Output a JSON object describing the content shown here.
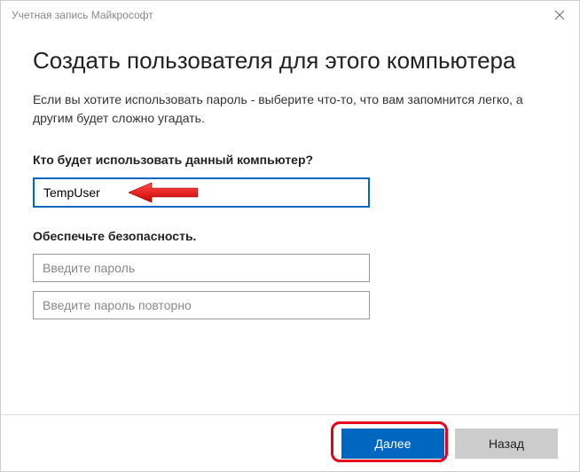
{
  "titlebar": {
    "title": "Учетная запись Майкрософт"
  },
  "main": {
    "heading": "Создать пользователя для этого компьютера",
    "description": "Если вы хотите использовать пароль - выберите что-то, что вам запомнится легко, а другим будет сложно угадать.",
    "username_label": "Кто будет использовать данный компьютер?",
    "username_value": "TempUser",
    "security_label": "Обеспечьте безопасность.",
    "password_placeholder": "Введите пароль",
    "password_confirm_placeholder": "Введите пароль повторно"
  },
  "footer": {
    "next_label": "Далее",
    "back_label": "Назад"
  },
  "colors": {
    "accent": "#0067c0",
    "annotation": "#e6001f"
  }
}
